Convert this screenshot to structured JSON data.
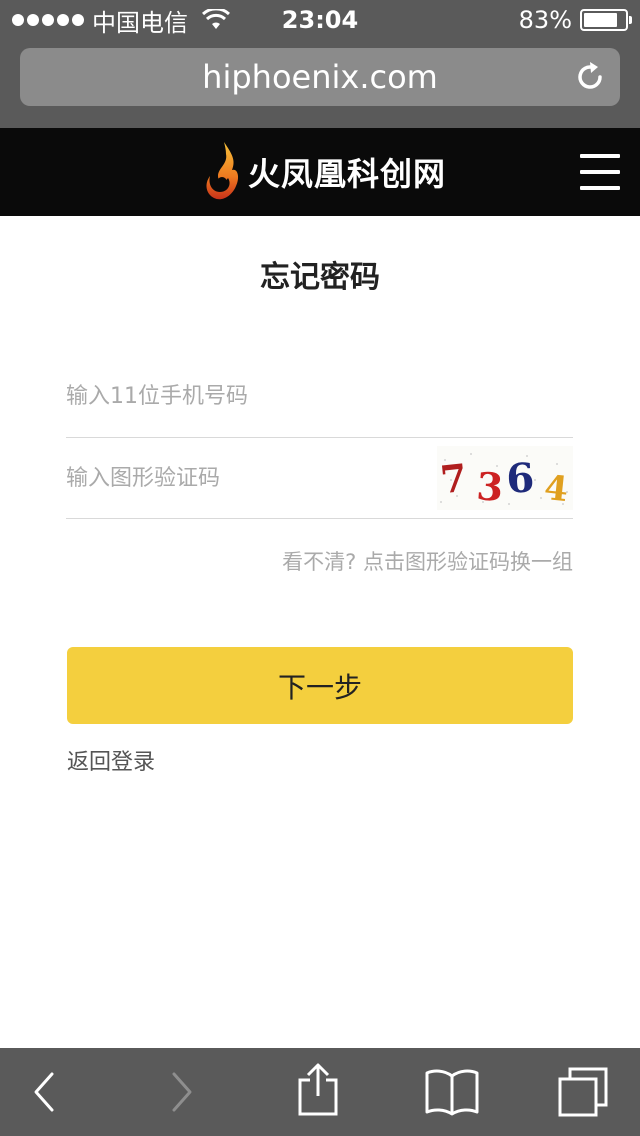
{
  "status_bar": {
    "carrier": "中国电信",
    "time": "23:04",
    "battery_percent": "83%",
    "battery_level": 0.83
  },
  "browser": {
    "url": "hiphoenix.com"
  },
  "site": {
    "logo_text": "火凤凰科创网"
  },
  "form": {
    "title": "忘记密码",
    "phone_placeholder": "输入11位手机号码",
    "captcha_placeholder": "输入图形验证码",
    "captcha_digits": [
      "7",
      "3",
      "6",
      "4"
    ],
    "captcha_colors": [
      "#b01e1e",
      "#cc2222",
      "#1e2a7a",
      "#e0a020"
    ],
    "hint": "看不清?  点击图形验证码换一组",
    "next_label": "下一步",
    "back_login_label": "返回登录"
  },
  "toolbar": {
    "icons": [
      "back-icon",
      "forward-icon",
      "share-icon",
      "bookmarks-icon",
      "tabs-icon"
    ]
  }
}
